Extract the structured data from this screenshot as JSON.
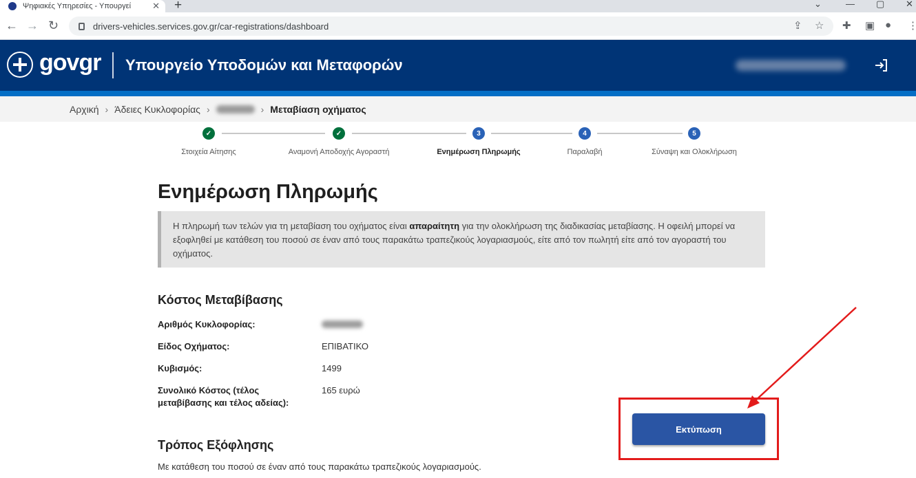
{
  "browser": {
    "tab_title": "Ψηφιακές Υπηρεσίες - Υπουργεί",
    "url": "drivers-vehicles.services.gov.gr/car-registrations/dashboard"
  },
  "header": {
    "logo": "govgr",
    "ministry": "Υπουργείο Υποδομών και Μεταφορών"
  },
  "breadcrumb": {
    "home": "Αρχική",
    "licenses": "Άδειες Κυκλοφορίας",
    "current": "Μεταβίαση οχήματος"
  },
  "stepper": {
    "steps": [
      {
        "label": "Στοιχεία Αίτησης",
        "status": "done"
      },
      {
        "label": "Αναμονή Αποδοχής Αγοραστή",
        "status": "done"
      },
      {
        "label": "Ενημέρωση Πληρωμής",
        "number": "3",
        "status": "active"
      },
      {
        "label": "Παραλαβή",
        "number": "4",
        "status": "todo"
      },
      {
        "label": "Σύναψη και Ολοκλήρωση",
        "number": "5",
        "status": "todo"
      }
    ]
  },
  "main": {
    "title": "Ενημέρωση Πληρωμής",
    "notice_part1": "Η πληρωμή των τελών για τη μεταβίαση του οχήματος είναι ",
    "notice_bold": "απαραίτητη",
    "notice_part2": " για την ολοκλήρωση της διαδικασίας μεταβίασης. Η οφειλή μπορεί να εξοφληθεί με κατάθεση του ποσού σε έναν από τους παρακάτω τραπεζικούς λογαριασμούς, είτε από τον πωλητή είτε από τον αγοραστή του οχήματος.",
    "cost_title": "Κόστος Μεταβίβασης",
    "rows": [
      {
        "key": "Αριθμός Κυκλοφορίας:",
        "value": ""
      },
      {
        "key": "Είδος Οχήματος:",
        "value": "ΕΠΙΒΑΤΙΚΟ"
      },
      {
        "key": "Κυβισμός:",
        "value": "1499"
      },
      {
        "key": "Συνολικό Κόστος (τέλος μεταβίβασης και τέλος αδείας):",
        "value": "165 ευρώ"
      }
    ],
    "print_button": "Εκτύπωση",
    "payment_title": "Τρόπος Εξόφλησης",
    "payment_desc": "Με κατάθεση του ποσού σε έναν από τους παρακάτω τραπεζικούς λογαριασμούς."
  },
  "colors": {
    "header_bg": "#003476",
    "header_stripe": "#046ec5",
    "button_bg": "#2a55a4",
    "step_done": "#00703c",
    "step_todo": "#2a62b7",
    "annotation": "#e31b1b"
  },
  "icons": {
    "back": "arrow-left-icon",
    "forward": "arrow-right-icon",
    "reload": "reload-icon",
    "lock": "lock-icon",
    "share": "share-icon",
    "star": "star-icon",
    "extensions": "puzzle-icon",
    "sidepanel": "sidepanel-icon",
    "profile": "profile-icon",
    "menu": "kebab-menu-icon",
    "logout": "logout-icon"
  }
}
